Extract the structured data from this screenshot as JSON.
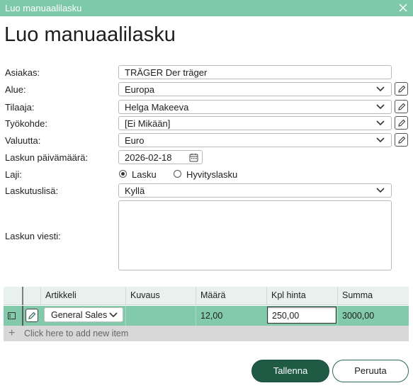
{
  "window": {
    "title": "Luo manuaalilasku"
  },
  "page": {
    "heading": "Luo manuaalilasku"
  },
  "form": {
    "asiakas": {
      "label": "Asiakas:",
      "value": "TRÄGER Der träger"
    },
    "alue": {
      "label": "Alue:",
      "value": "Europa"
    },
    "tilaaja": {
      "label": "Tilaaja:",
      "value": "Helga Makeeva"
    },
    "tyokohde": {
      "label": "Työkohde:",
      "value": "[Ei Mikään]"
    },
    "valuutta": {
      "label": "Valuutta:",
      "value": "Euro"
    },
    "paivamaara": {
      "label": "Laskun päivämäärä:",
      "value": "2026-02-18"
    },
    "laji": {
      "label": "Laji:",
      "options": [
        "Lasku",
        "Hyvityslasku"
      ],
      "selected": "Lasku"
    },
    "laskutuslisa": {
      "label": "Laskutuslisä:",
      "value": "Kyllä"
    },
    "viesti": {
      "label": "Laskun viesti:",
      "value": ""
    }
  },
  "grid": {
    "columns": [
      "Artikkeli",
      "Kuvaus",
      "Määrä",
      "Kpl hinta",
      "Summa"
    ],
    "row": {
      "artikkeli": "General Sales",
      "kuvaus": "",
      "maara": "12,00",
      "kpl_hinta": "250,00",
      "summa": "3000,00"
    },
    "add_row_label": "Click here to add new item"
  },
  "buttons": {
    "save": "Tallenna",
    "cancel": "Peruuta"
  },
  "colors": {
    "titlebar": "#7fc9ab",
    "selected_row": "#82caa9",
    "primary_button": "#1f5a45"
  }
}
